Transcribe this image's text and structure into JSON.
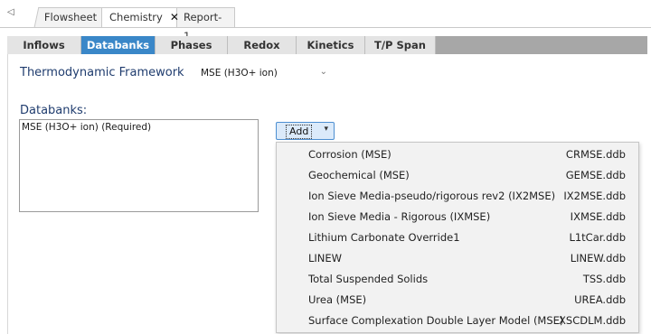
{
  "doc_tabs": {
    "flowsheet": "Flowsheet",
    "chemistry": "Chemistry",
    "chemistry_close": "✕",
    "report": "Report-1"
  },
  "subtabs": [
    "Inflows",
    "Databanks",
    "Phases",
    "Redox",
    "Kinetics",
    "T/P Span"
  ],
  "active_subtab": "Databanks",
  "framework": {
    "label": "Thermodynamic Framework",
    "value": "MSE (H3O+ ion)"
  },
  "databanks": {
    "label": "Databanks:",
    "items": [
      "MSE (H3O+ ion) (Required)"
    ]
  },
  "add_button": {
    "label": "Add"
  },
  "add_menu": [
    {
      "name": "Corrosion (MSE)",
      "file": "CRMSE.ddb"
    },
    {
      "name": "Geochemical (MSE)",
      "file": "GEMSE.ddb"
    },
    {
      "name": "Ion Sieve Media-pseudo/rigorous rev2 (IX2MSE)",
      "file": "IX2MSE.ddb"
    },
    {
      "name": "Ion Sieve Media - Rigorous (IXMSE)",
      "file": "IXMSE.ddb"
    },
    {
      "name": "Lithium Carbonate Override1",
      "file": "L1tCar.ddb"
    },
    {
      "name": "LINEW",
      "file": "LINEW.ddb"
    },
    {
      "name": "Total Suspended Solids",
      "file": "TSS.ddb"
    },
    {
      "name": "Urea (MSE)",
      "file": "UREA.ddb"
    },
    {
      "name": "Surface Complexation Double Layer Model (MSE)",
      "file": "XSCDLM.ddb"
    }
  ]
}
